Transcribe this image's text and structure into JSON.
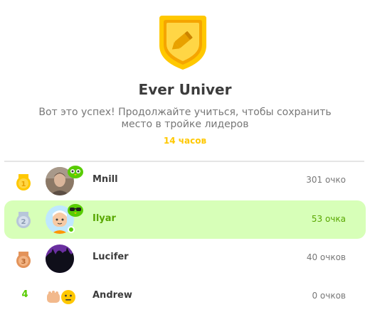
{
  "league": {
    "badge_icon": "pencil-shield-icon",
    "badge_color": "#ffc800",
    "title": "Ever Univer",
    "subtitle": "Вот это успех! Продолжайте учиться, чтобы сохранить место в тройке лидеров",
    "time_left": "14 часов"
  },
  "leaderboard": {
    "rows": [
      {
        "rank": "1",
        "rank_icon": "gold-medal-icon",
        "name": "Mnill",
        "points": "301 очко",
        "highlighted": false
      },
      {
        "rank": "2",
        "rank_icon": "silver-medal-icon",
        "name": "Ilyar",
        "points": "53 очка",
        "highlighted": true,
        "online": true
      },
      {
        "rank": "3",
        "rank_icon": "bronze-medal-icon",
        "name": "Lucifer",
        "points": "40 очков",
        "highlighted": false
      },
      {
        "rank": "4",
        "name": "Andrew",
        "points": "0 очков",
        "highlighted": false
      }
    ]
  },
  "colors": {
    "accent_green": "#58cc02",
    "highlight_bg": "#d7ffb8",
    "timer_yellow": "#ffc800"
  }
}
